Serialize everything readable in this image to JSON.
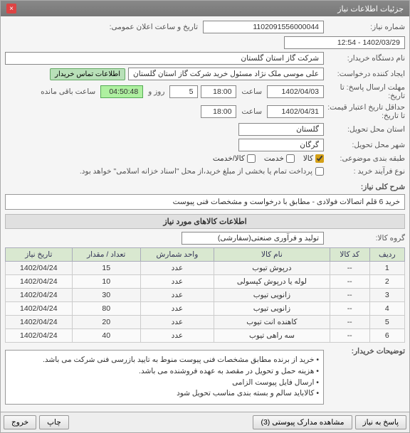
{
  "window": {
    "title": "جزئیات اطلاعات نیاز"
  },
  "fields": {
    "need_no_label": "شماره نیاز:",
    "need_no": "1102091556000044",
    "announce_label": "تاریخ و ساعت اعلان عمومی:",
    "announce_value": "1402/03/29 - 12:54",
    "buyer_org_label": "نام دستگاه خریدار:",
    "buyer_org": "شرکت گاز استان گلستان",
    "requester_label": "ایجاد کننده درخواست:",
    "requester": "علی موسی ملک نژاد مسئول خرید شرکت گاز استان گلستان",
    "contact_btn": "اطلاعات تماس خریدار",
    "deadline_label": "مهلت ارسال پاسخ: تا تاریخ:",
    "deadline_date": "1402/04/03",
    "time_lbl": "ساعت",
    "deadline_time": "18:00",
    "days_lbl1": "روز و",
    "days_remaining": "5",
    "time_remaining": "04:50:48",
    "remaining_lbl": "ساعت باقی مانده",
    "validity_label": "حداقل تاریخ اعتبار قیمت: تا تاریخ:",
    "validity_date": "1402/04/31",
    "validity_time": "18:00",
    "delivery_province_label": "استان محل تحویل:",
    "delivery_province": "گلستان",
    "delivery_city_label": "شهر محل تحویل:",
    "delivery_city": "گرگان",
    "subject_cat_label": "طبقه بندی موضوعی:",
    "cat1": "کالا",
    "cat2": "خدمت",
    "cat3": "کالا/خدمت",
    "purchase_type_label": "نوع فرآیند خرید :",
    "purchase_note": "پرداخت تمام یا بخشی از مبلغ خرید،از محل \"اسناد خزانه اسلامی\" خواهد بود.",
    "desc_label": "شرح کلی نیاز:",
    "desc_text": "خرید 6 قلم اتصالات فولادی - مطابق با درخواست و مشخصات فنی پیوست",
    "goods_section": "اطلاعات کالاهای مورد نیاز",
    "goods_group_label": "گروه کالا:",
    "goods_group": "تولید و فرآوری صنعتی(سفارشی)",
    "buyer_notes_label": "توضیحات خریدار:",
    "buyer_notes": [
      "خرید از برنده مطابق مشخصات فنی پیوست منوط به تایید بازرسی فنی شرکت می باشد.",
      "هزینه حمل و تحویل در مقصد به عهده فروشنده می باشد.",
      "ارسال فایل پیوست الزامی",
      "کالاباید سالم و بسته بندی مناسب تحویل شود"
    ]
  },
  "table": {
    "headers": {
      "row": "ردیف",
      "code": "کد کالا",
      "name": "نام کالا",
      "unit": "واحد شمارش",
      "qty": "تعداد / مقدار",
      "date": "تاریخ نیاز"
    },
    "rows": [
      {
        "n": "1",
        "code": "--",
        "name": "درپوش تیوب",
        "unit": "عدد",
        "qty": "15",
        "date": "1402/04/24"
      },
      {
        "n": "2",
        "code": "--",
        "name": "لوله یا درپوش کپسولی",
        "unit": "عدد",
        "qty": "10",
        "date": "1402/04/24"
      },
      {
        "n": "3",
        "code": "--",
        "name": "زانویی تیوب",
        "unit": "عدد",
        "qty": "30",
        "date": "1402/04/24"
      },
      {
        "n": "4",
        "code": "--",
        "name": "زانویی تیوب",
        "unit": "عدد",
        "qty": "80",
        "date": "1402/04/24"
      },
      {
        "n": "5",
        "code": "--",
        "name": "کاهنده انت تیوب",
        "unit": "عدد",
        "qty": "20",
        "date": "1402/04/24"
      },
      {
        "n": "6",
        "code": "--",
        "name": "سه راهی تیوب",
        "unit": "عدد",
        "qty": "40",
        "date": "1402/04/24"
      }
    ]
  },
  "buttons": {
    "reply": "پاسخ به نیاز",
    "attachments": "مشاهده مدارک پیوستی (3)",
    "print": "چاپ",
    "exit": "خروج"
  }
}
